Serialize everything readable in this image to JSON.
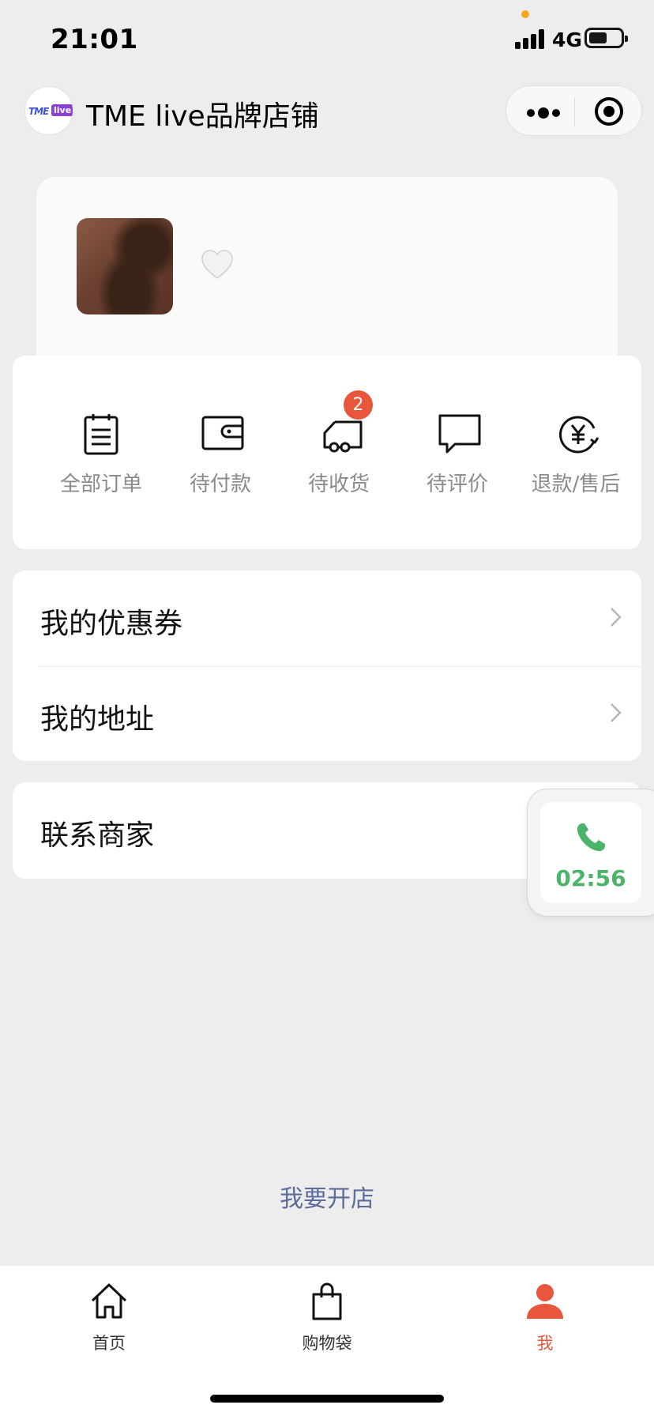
{
  "status_bar": {
    "time": "21:01",
    "network": "4G"
  },
  "nav": {
    "logo_text_1": "TME",
    "logo_text_2": "live",
    "title": "TME live品牌店铺"
  },
  "orders": {
    "items": [
      {
        "label": "全部订单",
        "icon": "clipboard-icon"
      },
      {
        "label": "待付款",
        "icon": "wallet-icon"
      },
      {
        "label": "待收货",
        "icon": "truck-icon",
        "badge": "2"
      },
      {
        "label": "待评价",
        "icon": "comment-icon"
      },
      {
        "label": "退款/售后",
        "icon": "refund-icon"
      }
    ]
  },
  "menu": {
    "coupons": "我的优惠券",
    "address": "我的地址",
    "contact": "联系商家"
  },
  "call": {
    "duration": "02:56",
    "color": "#4cb36a"
  },
  "open_shop": "我要开店",
  "tabbar": {
    "items": [
      {
        "label": "首页",
        "icon": "home-icon"
      },
      {
        "label": "购物袋",
        "icon": "shopping-bag-icon"
      },
      {
        "label": "我",
        "icon": "user-icon",
        "active": true
      }
    ],
    "active_color": "#e8563b"
  }
}
